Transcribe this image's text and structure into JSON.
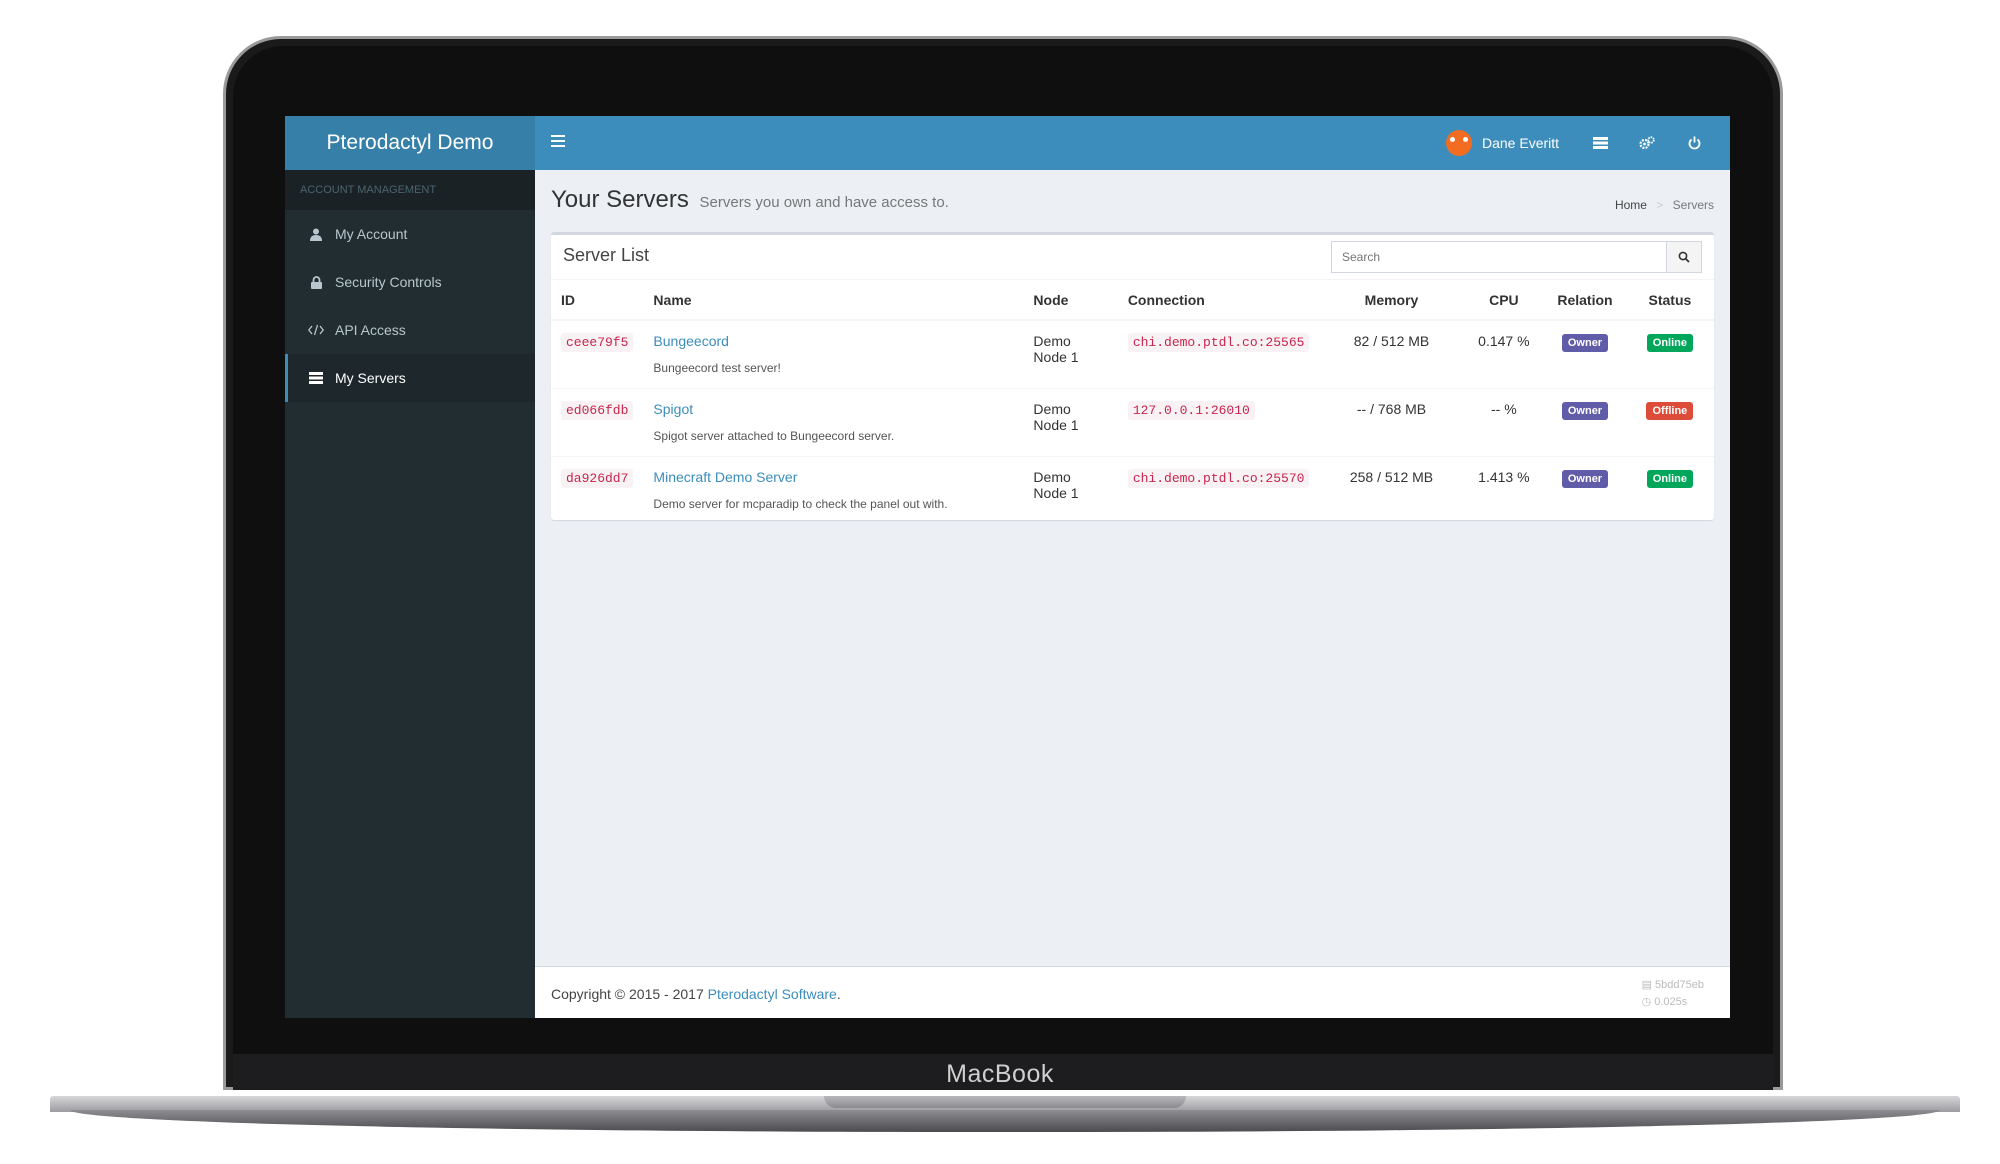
{
  "device": {
    "brand": "MacBook"
  },
  "app": {
    "logo": "Pterodactyl Demo"
  },
  "sidebar": {
    "header": "Account Management",
    "items": [
      {
        "label": "My Account",
        "icon": "user-icon"
      },
      {
        "label": "Security Controls",
        "icon": "lock-icon"
      },
      {
        "label": "API Access",
        "icon": "code-icon"
      },
      {
        "label": "My Servers",
        "icon": "server-icon",
        "active": true
      }
    ]
  },
  "topbar": {
    "user_name": "Dane Everitt",
    "icons": [
      "server-icon",
      "gears-icon",
      "power-icon"
    ]
  },
  "page": {
    "title": "Your Servers",
    "subtitle": "Servers you own and have access to.",
    "breadcrumb": {
      "home": "Home",
      "current": "Servers"
    }
  },
  "server_list": {
    "title": "Server List",
    "search_placeholder": "Search",
    "columns": [
      "ID",
      "Name",
      "Node",
      "Connection",
      "Memory",
      "CPU",
      "Relation",
      "Status"
    ],
    "rows": [
      {
        "id": "ceee79f5",
        "name": "Bungeecord",
        "description": "Bungeecord test server!",
        "node": "Demo Node 1",
        "connection": "chi.demo.ptdl.co:25565",
        "memory": "82 / 512 MB",
        "cpu": "0.147 %",
        "relation": "Owner",
        "status": "Online"
      },
      {
        "id": "ed066fdb",
        "name": "Spigot",
        "description": "Spigot server attached to Bungeecord server.",
        "node": "Demo Node 1",
        "connection": "127.0.0.1:26010",
        "memory": "-- / 768 MB",
        "cpu": "-- %",
        "relation": "Owner",
        "status": "Offline"
      },
      {
        "id": "da926dd7",
        "name": "Minecraft Demo Server",
        "description": "Demo server for mcparadip to check the panel out with.",
        "node": "Demo Node 1",
        "connection": "chi.demo.ptdl.co:25570",
        "memory": "258 / 512 MB",
        "cpu": "1.413 %",
        "relation": "Owner",
        "status": "Online"
      }
    ]
  },
  "footer": {
    "copyright_prefix": "Copyright © 2015 - 2017 ",
    "copyright_link": "Pterodactyl Software",
    "copyright_suffix": ".",
    "commit": "5bdd75eb",
    "render_time": "0.025s"
  },
  "colors": {
    "topbar": "#3c8dbc",
    "logo_bg": "#367fa9",
    "sidebar_bg": "#222d32",
    "owner_badge": "#605ca8",
    "online_badge": "#00a65a",
    "offline_badge": "#dd4b39"
  }
}
